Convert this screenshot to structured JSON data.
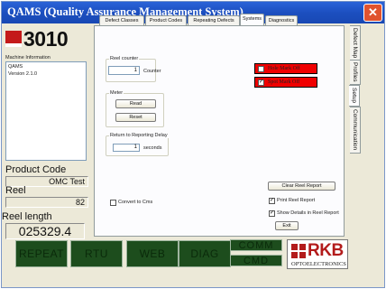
{
  "window": {
    "title": "QAMS (Quality Assurance Management System)",
    "close": "✕"
  },
  "logo": {
    "number": "3010"
  },
  "machine": {
    "label": "Machine Information",
    "lines": [
      "QAMS",
      "Version 2.1.0"
    ]
  },
  "product": {
    "label": "Product Code",
    "value": "OMC Test"
  },
  "reel": {
    "label": "Reel",
    "value": "82"
  },
  "reel_length": {
    "label": "Reel length",
    "value": "025329.4"
  },
  "tabs": [
    "Defect Classes",
    "Product Codes",
    "Repeating Defects",
    "Systems",
    "Diagnostics"
  ],
  "side_tabs": [
    "Defect Map",
    "Profiles",
    "Setup",
    "Communication"
  ],
  "reel_counter": {
    "label": "Reel counter",
    "value": "1",
    "unit": "Counter"
  },
  "meter": {
    "label": "Meter",
    "read": "Read",
    "reset": "Reset"
  },
  "return_delay": {
    "label": "Return to Reporting Delay",
    "value": "1",
    "unit": "seconds"
  },
  "hole_mark": {
    "label": "Hole Mark Off",
    "checked": false
  },
  "spot_mark": {
    "label": "Spot Mark Off",
    "checked": true,
    "mark": "✓"
  },
  "convert_cms": {
    "label": "Convert to Cms"
  },
  "clear_reel": "Clear Reel Report",
  "print_reel": {
    "label": "Print Reel Report",
    "mark": "✓"
  },
  "show_details": {
    "label": "Show Details in Reel Report",
    "mark": "✓"
  },
  "exit": "Exit",
  "bottom": {
    "repeat": "REPEAT",
    "rtu": "RTU",
    "web": "WEB",
    "diag": "DIAG",
    "comm": "COMM",
    "cmd": "CMD"
  },
  "brand": {
    "name": "RKB",
    "sub": "OPTOELECTRONICS"
  },
  "colors": {
    "title_bar": "#1c4fc0",
    "mark_red": "#f00000",
    "status_green": "#1d4d1d",
    "brand_red": "#b31b1b"
  }
}
